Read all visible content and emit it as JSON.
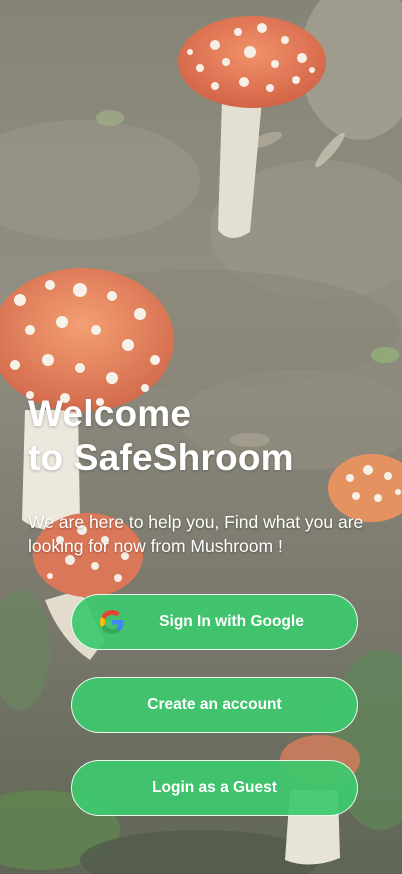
{
  "welcome": {
    "title_line1": "Welcome",
    "title_line2": "to SafeShroom",
    "subtitle": "We are here to help  you, Find what you are looking for now from Mushroom !"
  },
  "buttons": {
    "google": {
      "label": "Sign In with Google",
      "icon": "google-icon"
    },
    "create": {
      "label": "Create an account"
    },
    "guest": {
      "label": "Login as a Guest"
    }
  },
  "colors": {
    "button_green": "#3dc96e",
    "text": "#ffffff",
    "mushroom_cap": "#d8552e"
  }
}
